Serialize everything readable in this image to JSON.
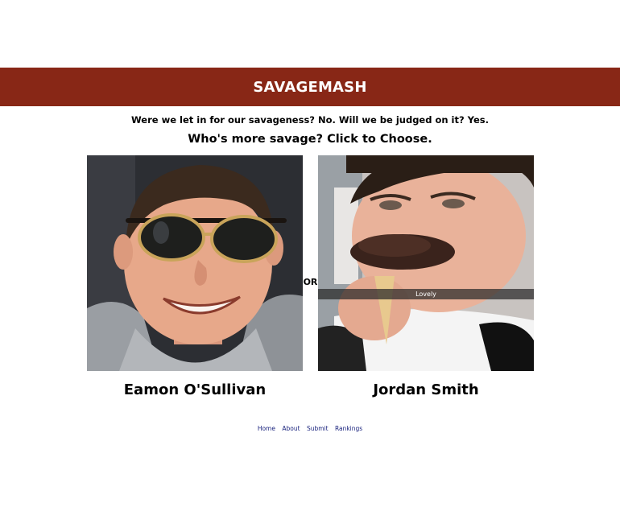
{
  "site": {
    "title": "SAVAGEMASH",
    "tagline": "Were we let in for our savageness? No. Will we be judged on it? Yes.",
    "prompt": "Who's more savage? Click to Choose.",
    "separator": "OR"
  },
  "colors": {
    "banner": "#882716",
    "footer_link": "#1a237e"
  },
  "contestants": [
    {
      "name": "Eamon O'Sullivan",
      "photo_description_icon": "portrait-sunglasses-photo"
    },
    {
      "name": "Jordan Smith",
      "photo_description_icon": "portrait-ice-cream-photo",
      "photo_caption": "Lovely"
    }
  ],
  "footer": {
    "links": [
      "Home",
      "About",
      "Submit",
      "Rankings"
    ]
  }
}
